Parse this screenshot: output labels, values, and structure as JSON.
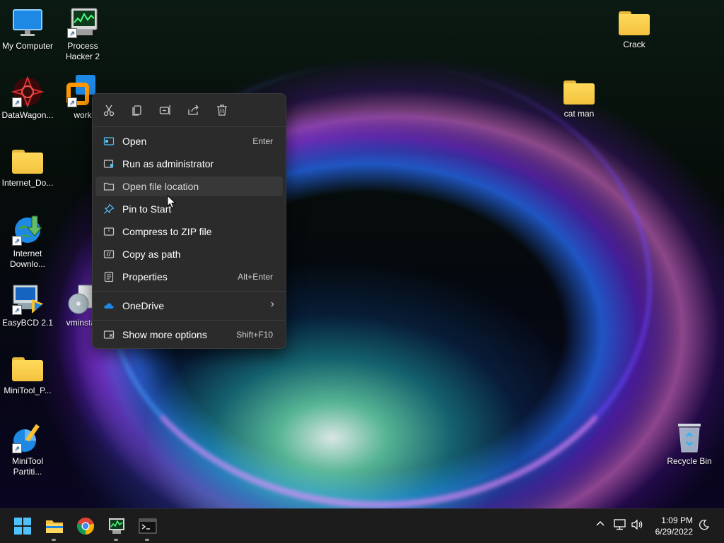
{
  "desktop_icons": [
    {
      "label": "My Computer"
    },
    {
      "label": "Process Hacker 2"
    },
    {
      "label": "DataWagon..."
    },
    {
      "label": "work"
    },
    {
      "label": "Internet_Do..."
    },
    {
      "label": "Internet Downlo..."
    },
    {
      "label": "EasyBCD 2.1"
    },
    {
      "label": "vminstall"
    },
    {
      "label": "MiniTool_P..."
    },
    {
      "label": "MiniTool Partiti..."
    },
    {
      "label": "Crack"
    },
    {
      "label": "cat man"
    },
    {
      "label": "Recycle Bin"
    }
  ],
  "context_menu": {
    "toolbar": [
      "cut-icon",
      "copy-icon",
      "rename-icon",
      "share-icon",
      "delete-icon"
    ],
    "items": [
      {
        "label": "Open",
        "shortcut": "Enter",
        "icon": "open-icon"
      },
      {
        "label": "Run as administrator",
        "shortcut": "",
        "icon": "shield-icon"
      },
      {
        "label": "Open file location",
        "shortcut": "",
        "icon": "folder-icon"
      },
      {
        "label": "Pin to Start",
        "shortcut": "",
        "icon": "pin-icon"
      },
      {
        "label": "Compress to ZIP file",
        "shortcut": "",
        "icon": "zip-icon"
      },
      {
        "label": "Copy as path",
        "shortcut": "",
        "icon": "path-icon"
      },
      {
        "label": "Properties",
        "shortcut": "Alt+Enter",
        "icon": "properties-icon"
      },
      {
        "label": "OneDrive",
        "shortcut": "",
        "icon": "cloud-icon"
      },
      {
        "label": "Show more options",
        "shortcut": "Shift+F10",
        "icon": "more-options-icon"
      }
    ]
  },
  "taskbar": {
    "apps": [
      "start-icon",
      "file-explorer-icon",
      "chrome-icon",
      "process-hacker-icon",
      "terminal-icon"
    ],
    "clock": {
      "time": "1:09 PM",
      "date": "6/29/2022"
    }
  },
  "colors": {
    "menu_bg": "#2b2b2b",
    "taskbar_bg": "#1c1c1c",
    "folder": "#f3c23f",
    "accent": "#0078d4"
  }
}
